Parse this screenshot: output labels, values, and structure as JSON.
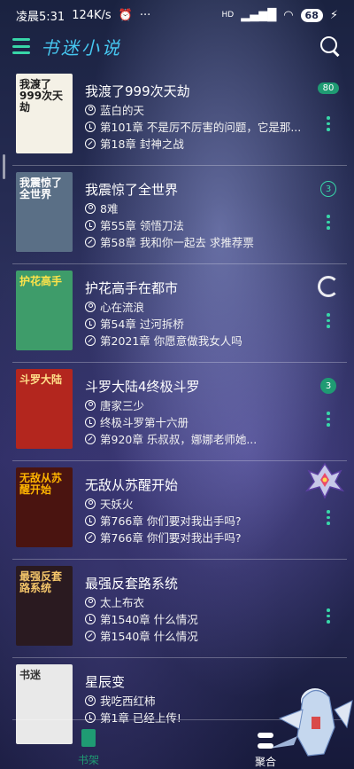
{
  "status_bar": {
    "time": "凌晨5:31",
    "speed": "124K/s",
    "alarm_icon": "alarm-icon",
    "dots": "···",
    "signal": "HD",
    "battery": "68"
  },
  "app": {
    "title": "书迷小说",
    "menu_icon": "menu-icon",
    "search_icon": "search-icon"
  },
  "books": [
    {
      "title": "我渡了999次天劫",
      "author": "蓝白的天",
      "latest": "第101章 不是厉不厉害的问题，它是那...",
      "read": "第18章 封神之战",
      "badge": "80",
      "badge_style": "pill",
      "cover_text": "我渡了999次天劫",
      "cover_color": "#f4f1e6",
      "cover_text_color": "#1c1c1c"
    },
    {
      "title": "我震惊了全世界",
      "author": "8难",
      "latest": "第55章 领悟刀法",
      "read": "第58章 我和你一起去 求推荐票",
      "badge": "3",
      "badge_style": "circle",
      "cover_text": "我震惊了全世界",
      "cover_color": "#5a6f86",
      "cover_text_color": "#ffffff"
    },
    {
      "title": "护花高手在都市",
      "author": "心在流浪",
      "latest": "第54章 过河拆桥",
      "read": "第2021章 你愿意做我女人吗",
      "badge": "",
      "badge_style": "spinner",
      "cover_text": "护花高手",
      "cover_color": "#3e9c6a",
      "cover_text_color": "#ffe44a"
    },
    {
      "title": "斗罗大陆4终极斗罗",
      "author": "唐家三少",
      "latest": "终极斗罗第十六册",
      "read": "第920章 乐叔叔，娜娜老师她...",
      "badge": "3",
      "badge_style": "filled",
      "cover_text": "斗罗大陆",
      "cover_color": "#b3261e",
      "cover_text_color": "#ffe08a"
    },
    {
      "title": "无敌从苏醒开始",
      "author": "天妖火",
      "latest": "第766章 你们要对我出手吗?",
      "read": "第766章 你们要对我出手吗?",
      "badge": "",
      "badge_style": "none",
      "cover_text": "无敌从苏醒开始",
      "cover_color": "#4a1410",
      "cover_text_color": "#ffb400"
    },
    {
      "title": "最强反套路系统",
      "author": "太上布衣",
      "latest": "第1540章 什么情况",
      "read": "第1540章 什么情况",
      "badge": "",
      "badge_style": "none",
      "cover_text": "最强反套路系统",
      "cover_color": "#2a1a20",
      "cover_text_color": "#f4c56a"
    },
    {
      "title": "星辰变",
      "author": "我吃西红柿",
      "latest": "第1章 已经上传!",
      "read": "",
      "badge": "",
      "badge_style": "none",
      "cover_text": "书迷",
      "cover_color": "#e9e9e9",
      "cover_text_color": "#333333"
    }
  ],
  "bottom_nav": {
    "bookshelf_label": "书架",
    "aggregate_label": "聚合"
  },
  "colors": {
    "accent": "#1f9b73",
    "title_blue": "#46c7f0"
  }
}
